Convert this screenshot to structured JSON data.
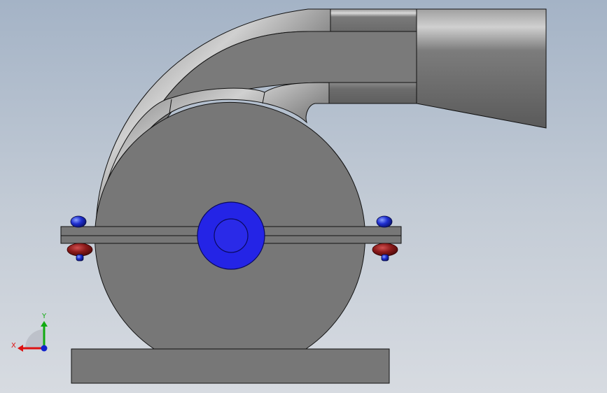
{
  "viewport": {
    "background_top": "#a4b3c6",
    "background_bottom": "#d7dbe1"
  },
  "model": {
    "part_color": "#777777",
    "outline_color": "#111111",
    "shaft_color": "#2a2ae8",
    "bolt_head_color": "#1f2fd0",
    "nut_color": "#8b1a1a"
  },
  "triad": {
    "x_label": "X",
    "y_label": "Y",
    "x_color": "#d11",
    "y_color": "#1a1",
    "z_color": "#12c"
  }
}
